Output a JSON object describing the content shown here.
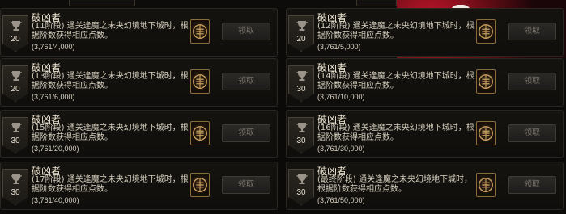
{
  "claim_label": "领取",
  "cards": [
    {
      "title": "破凶者",
      "desc": "(11阶段) 通关逢魔之未央幻境地下城时，根据阶数获得相应点数。",
      "progress": "(3,761/4,000)",
      "points": "20"
    },
    {
      "title": "破凶者",
      "desc": "(12阶段) 通关逢魔之未央幻境地下城时，根据阶数获得相应点数。",
      "progress": "(3,761/5,000)",
      "points": "20"
    },
    {
      "title": "破凶者",
      "desc": "(13阶段) 通关逢魔之未央幻境地下城时，根据阶数获得相应点数。",
      "progress": "(3,761/6,000)",
      "points": "20"
    },
    {
      "title": "破凶者",
      "desc": "(14阶段) 通关逢魔之未央幻境地下城时，根据阶数获得相应点数。",
      "progress": "(3,761/10,000)",
      "points": "30"
    },
    {
      "title": "破凶者",
      "desc": "(15阶段) 通关逢魔之未央幻境地下城时，根据阶数获得相应点数。",
      "progress": "(3,761/20,000)",
      "points": "30"
    },
    {
      "title": "破凶者",
      "desc": "(16阶段) 通关逢魔之未央幻境地下城时，根据阶数获得相应点数。",
      "progress": "(3,761/30,000)",
      "points": "30"
    },
    {
      "title": "破凶者",
      "desc": "(17阶段) 通关逢魔之未央幻境地下城时，根据阶数获得相应点数。",
      "progress": "(3,761/40,000)",
      "points": "30"
    },
    {
      "title": "破凶者",
      "desc": "(最终阶段) 通关逢魔之未央幻境地下城时，根据阶数获得相应点数。",
      "progress": "(3,761/50,000)",
      "points": "30"
    }
  ],
  "colors": {
    "card_bg": "#15130f",
    "border": "#2b2620",
    "gold": "#8a6b3c",
    "banner_red": "#c2162b"
  }
}
